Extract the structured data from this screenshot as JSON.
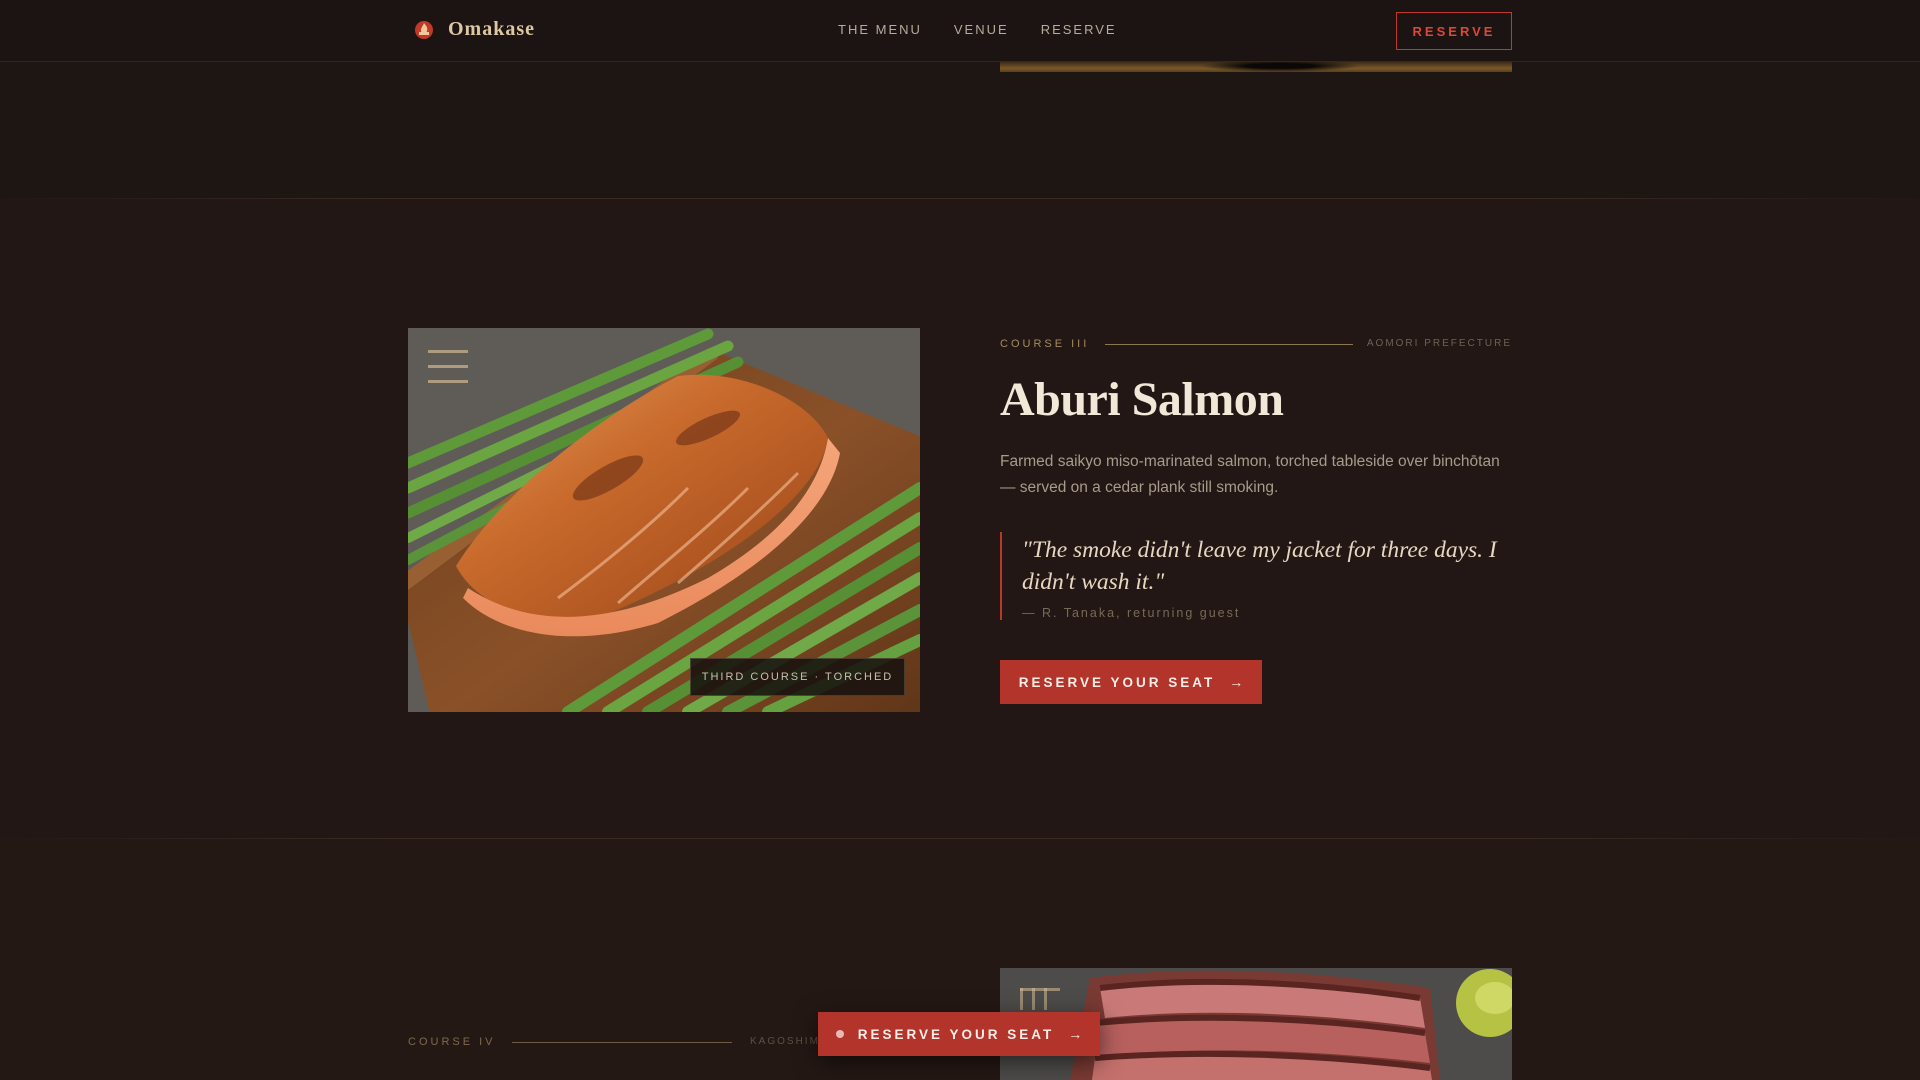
{
  "nav": {
    "brand": "Omakase",
    "links": [
      "THE MENU",
      "VENUE",
      "RESERVE"
    ],
    "reserve_button": "RESERVE"
  },
  "course3": {
    "course_label": "COURSE III",
    "location": "AOMORI PREFECTURE",
    "title": "Aburi Salmon",
    "description": "Farmed saikyo miso-marinated salmon, torched tableside over binchōtan — served on a cedar plank still smoking.",
    "quote": "\"The smoke didn't leave my jacket for three days. I didn't wash it.\"",
    "quote_attribution": "— R. Tanaka, returning guest",
    "cta": "RESERVE YOUR SEAT",
    "photo_caption": "THIRD COURSE · TORCHED"
  },
  "course4": {
    "course_label": "COURSE IV",
    "location": "KAGOSHIMA"
  },
  "floating_cta": "RESERVE YOUR SEAT",
  "icons": {
    "brand": "flame-icon",
    "arrow": "arrow-right-icon",
    "photo_badge": "menu-lines-icon"
  },
  "colors": {
    "accent": "#b3342a",
    "gold": "#a58b63",
    "background": "#221714"
  }
}
